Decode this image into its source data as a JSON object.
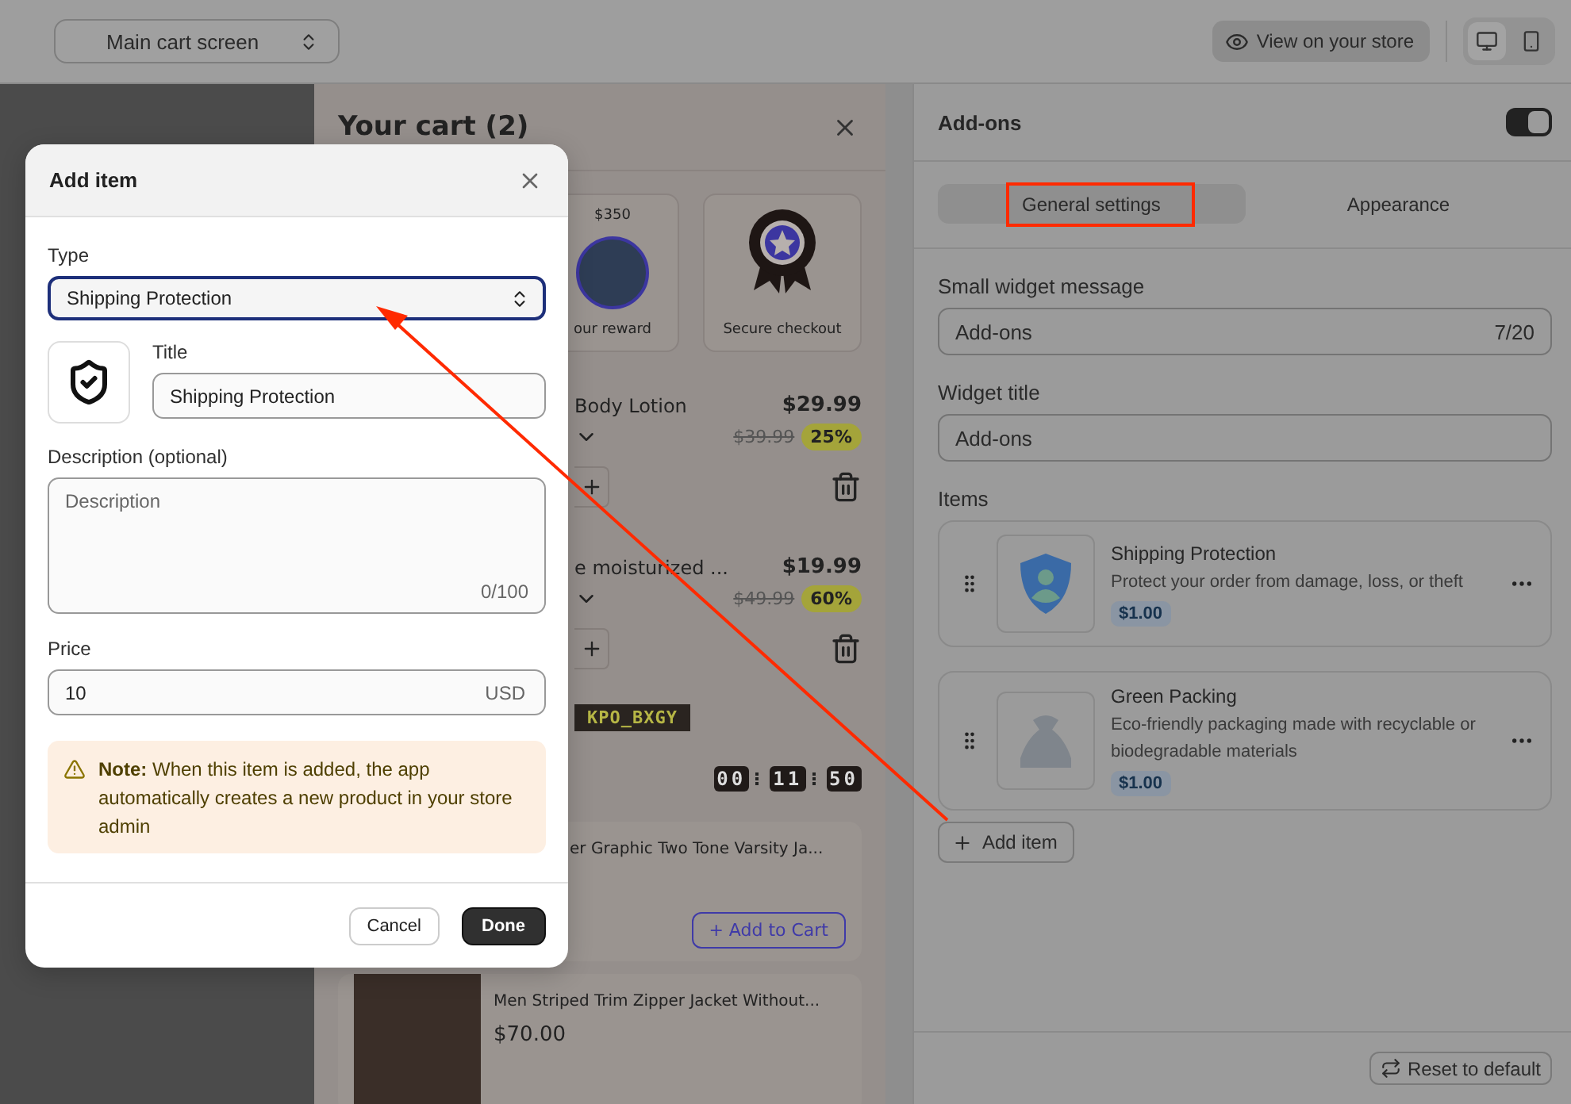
{
  "toolbar": {
    "screen_select": "Main cart screen",
    "view_button": "View on your store",
    "devices": [
      {
        "kind": "desktop",
        "selected": true
      },
      {
        "kind": "mobile",
        "selected": false
      }
    ]
  },
  "cart": {
    "title": "Your cart (2)",
    "badges": [
      {
        "kind": "reward",
        "price": "$350",
        "label": "our reward"
      },
      {
        "kind": "checkout",
        "label": "Secure checkout"
      }
    ],
    "items": [
      {
        "name": "Body Lotion",
        "price": "$29.99",
        "old_price": "$39.99",
        "discount": "25%"
      },
      {
        "name": "e moisturized ...",
        "price": "$19.99",
        "old_price": "$49.99",
        "discount": "60%"
      }
    ],
    "coupon": "KPO_BXGY",
    "timer": [
      "00",
      "11",
      "50"
    ],
    "recommendations": [
      {
        "name": "er Graphic Two Tone Varsity Ja...",
        "button": "+ Add to Cart"
      },
      {
        "name": "Men Striped Trim Zipper Jacket Without...",
        "price": "$70.00"
      }
    ]
  },
  "dialog": {
    "title": "Add item",
    "type_label": "Type",
    "type_value": "Shipping Protection",
    "title_label": "Title",
    "title_value": "Shipping Protection",
    "description_label": "Description (optional)",
    "description_placeholder": "Description",
    "description_counter": "0/100",
    "price_label": "Price",
    "price_value": "10",
    "currency": "USD",
    "note": "**Note:** When this item is added, the app automatically creates a new product in your store admin",
    "cancel": "Cancel",
    "done": "Done"
  },
  "settings": {
    "title": "Add-ons",
    "enabled": true,
    "tabs": [
      {
        "label": "General settings",
        "selected": true
      },
      {
        "label": "Appearance",
        "selected": false
      }
    ],
    "fields": [
      {
        "label": "Small widget message",
        "value": "Add-ons",
        "counter": "7/20"
      },
      {
        "label": "Widget title",
        "value": "Add-ons"
      }
    ],
    "items_label": "Items",
    "items": [
      {
        "kind": "shield",
        "title": "Shipping Protection",
        "description": "Protect your order from damage, loss, or theft",
        "price": "$1.00"
      },
      {
        "kind": "bag",
        "title": "Green Packing",
        "description": "Eco-friendly packaging made with recyclable or biodegradable materials",
        "price": "$1.00"
      }
    ],
    "add_button": "Add item",
    "reset_button": "Reset to default"
  }
}
